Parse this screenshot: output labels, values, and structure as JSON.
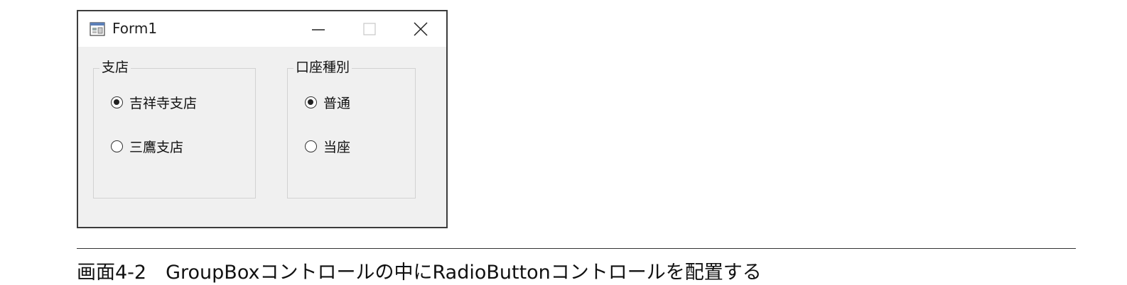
{
  "window": {
    "title": "Form1",
    "controls": {
      "minimize": "minimize",
      "maximize": "maximize",
      "close": "close"
    }
  },
  "groups": [
    {
      "title": "支店",
      "options": [
        {
          "label": "吉祥寺支店",
          "checked": true
        },
        {
          "label": "三鷹支店",
          "checked": false
        }
      ]
    },
    {
      "title": "口座種別",
      "options": [
        {
          "label": "普通",
          "checked": true
        },
        {
          "label": "当座",
          "checked": false
        }
      ]
    }
  ],
  "caption": "画面4-2　GroupBoxコントロールの中にRadioButtonコントロールを配置する"
}
